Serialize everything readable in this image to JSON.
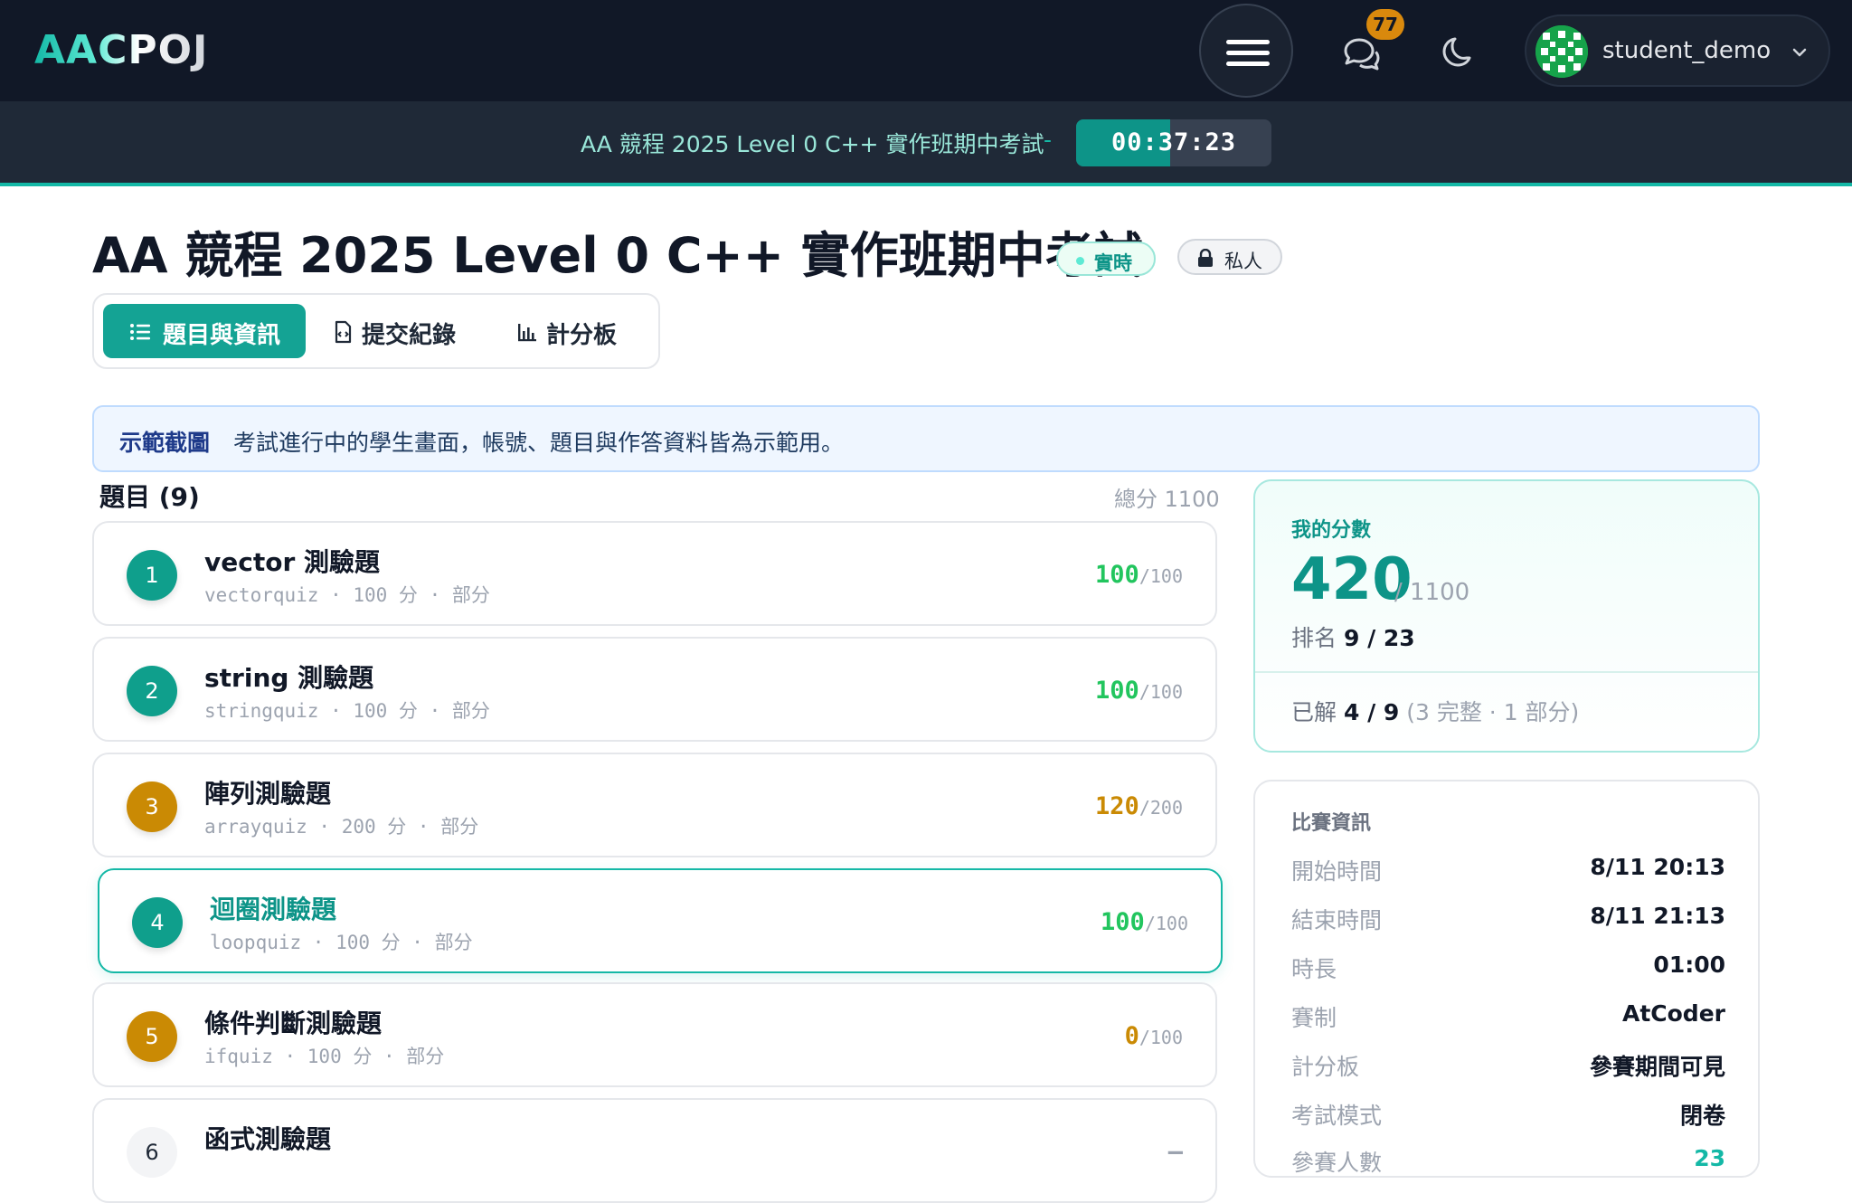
{
  "navbar": {
    "logo_text": "AACPOJ",
    "chat_badge": "77",
    "username": "student_demo"
  },
  "timer": {
    "contest_title": "AA 競程 2025 Level 0 C++ 實作班期中考試",
    "separator": "-",
    "time_left": "00:37:23",
    "elapsed_fraction": 0.48
  },
  "header": {
    "title": "AA 競程 2025 Level 0 C++ 實作班期中考試",
    "live_badge": "實時",
    "private_badge": "私人"
  },
  "tabs": [
    {
      "label": "題目與資訊",
      "icon": "list-icon",
      "active": true
    },
    {
      "label": "提交紀錄",
      "icon": "file-code-icon",
      "active": false
    },
    {
      "label": "計分板",
      "icon": "bar-chart-icon",
      "active": false
    }
  ],
  "notice": {
    "strong": "示範截圖",
    "text": "考試進行中的學生畫面，帳號、題目與作答資料皆為示範用。"
  },
  "problems": {
    "heading": "題目 (9)",
    "total_label": "總分 1100",
    "items": [
      {
        "num": "1",
        "title": "vector 測驗題",
        "sub": "vectorquiz · 100 分 · 部分",
        "got": "100",
        "max": "/100"
      },
      {
        "num": "2",
        "title": "string 測驗題",
        "sub": "stringquiz · 100 分 · 部分",
        "got": "100",
        "max": "/100"
      },
      {
        "num": "3",
        "title": "陣列測驗題",
        "sub": "arrayquiz · 200 分 · 部分",
        "got": "120",
        "max": "/200"
      },
      {
        "num": "4",
        "title": "迴圈測驗題",
        "sub": "loopquiz · 100 分 · 部分",
        "got": "100",
        "max": "/100"
      },
      {
        "num": "5",
        "title": "條件判斷測驗題",
        "sub": "ifquiz · 100 分 · 部分",
        "got": "0",
        "max": "/100"
      },
      {
        "num": "6",
        "title": "函式測驗題",
        "sub": "",
        "got": "–",
        "max": ""
      }
    ]
  },
  "score": {
    "label": "我的分數",
    "value": "420",
    "max": "/ 1100",
    "rank_label": "排名",
    "rank_value": "9 / 23",
    "solved_label": "已解",
    "solved_value": "4 / 9",
    "solved_detail": "(3 完整 · 1 部分)"
  },
  "info": {
    "title": "比賽資訊",
    "rows": [
      {
        "key": "開始時間",
        "value": "8/11 20:13"
      },
      {
        "key": "結束時間",
        "value": "8/11 21:13"
      },
      {
        "key": "時長",
        "value": "01:00"
      },
      {
        "key": "賽制",
        "value": "AtCoder"
      },
      {
        "key": "計分板",
        "value": "參賽期間可見"
      },
      {
        "key": "考試模式",
        "value": "閉卷"
      },
      {
        "key": "參賽人數",
        "value": "23"
      }
    ]
  },
  "colors": {
    "accent": "#14b8a6",
    "navbar_bg": "#111827",
    "score_green": "#22c55e",
    "score_amber": "#ca8a04"
  }
}
